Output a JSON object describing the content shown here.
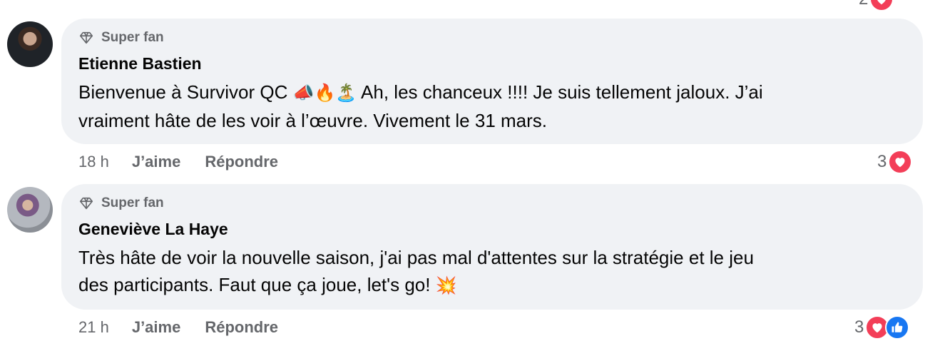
{
  "top_partial": {
    "reaction_count": "2"
  },
  "comments": [
    {
      "badge": "Super fan",
      "name": "Etienne Bastien",
      "line1": "Bienvenue à Survivor QC ",
      "emojis1": "📣🔥🏝️",
      "line1b": " Ah, les chanceux !!!! Je suis tellement jaloux. J’ai",
      "line2": "vraiment hâte de les voir à l’œuvre. Vivement le 31 mars.",
      "time": "18 h",
      "like_label": "J’aime",
      "reply_label": "Répondre",
      "reaction_count": "3",
      "reactions": [
        "heart"
      ]
    },
    {
      "badge": "Super fan",
      "name": "Geneviève La Haye",
      "line1": "Très hâte de voir la nouvelle saison, j'ai pas mal d'attentes sur la stratégie et le jeu",
      "line2": "des participants. Faut que ça joue, let's go! ",
      "emojis2": "💥",
      "time": "21 h",
      "like_label": "J’aime",
      "reply_label": "Répondre",
      "reaction_count": "3",
      "reactions": [
        "heart",
        "like"
      ]
    }
  ]
}
